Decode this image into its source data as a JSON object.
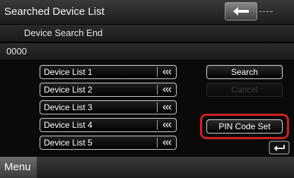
{
  "header": {
    "title": "Searched Device List",
    "clock": "----"
  },
  "status": {
    "message": "Device Search End",
    "pin": "0000"
  },
  "device_list": [
    {
      "label": "Device List 1"
    },
    {
      "label": "Device List 2"
    },
    {
      "label": "Device List 3"
    },
    {
      "label": "Device List 4"
    },
    {
      "label": "Device List 5"
    }
  ],
  "actions": {
    "search": "Search",
    "cancel": "Cancel",
    "pin_code_set": "PIN Code Set"
  },
  "menu": {
    "label": "Menu"
  },
  "colors": {
    "highlight": "#d42020",
    "background": "#000000"
  }
}
